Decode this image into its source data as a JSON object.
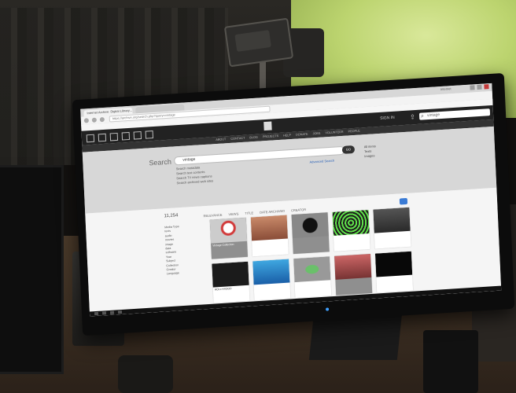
{
  "browser": {
    "tabs": [
      {
        "label": "Internet Archive: Digital Library..."
      },
      {
        "label": ""
      }
    ],
    "address": "https://archive.org/search.php?query=vintage",
    "window_label": "Internet"
  },
  "site": {
    "signin": "SIGN IN",
    "search_placeholder": "vintage",
    "nav": [
      "ABOUT",
      "CONTACT",
      "BLOG",
      "PROJECTS",
      "HELP",
      "DONATE",
      "JOBS",
      "VOLUNTEER",
      "PEOPLE"
    ]
  },
  "search": {
    "title": "Search",
    "query": "vintage",
    "go": "GO",
    "options": [
      "Search metadata",
      "Search text contents",
      "Search TV news captions",
      "Search archived web sites"
    ],
    "advanced": "Advanced Search",
    "radios": [
      "All items",
      "Texts",
      "Images"
    ]
  },
  "results": {
    "count": "11,254",
    "filters": [
      "RELEVANCE",
      "VIEWS",
      "TITLE",
      "DATE ARCHIVED",
      "CREATOR"
    ],
    "facets": [
      "Media Type",
      "texts",
      "audio",
      "movies",
      "image",
      "data",
      "software",
      "Year",
      "Subject",
      "Collection",
      "Creator",
      "Language"
    ],
    "tiles": [
      {
        "style": "collection red",
        "caption": "Vintage Collection",
        "stats": ""
      },
      {
        "style": "face",
        "caption": "",
        "stats": ""
      },
      {
        "style": "collection black-circle",
        "caption": "",
        "stats": ""
      },
      {
        "style": "spiral",
        "caption": "",
        "stats": ""
      },
      {
        "style": "portrait",
        "caption": "",
        "stats": ""
      },
      {
        "style": "poster",
        "caption": "HOLLYWOOD",
        "stats": ""
      },
      {
        "style": "blue",
        "caption": "",
        "stats": ""
      },
      {
        "style": "green-bottle",
        "caption": "",
        "stats": ""
      },
      {
        "style": "collection person",
        "caption": "",
        "stats": ""
      },
      {
        "style": "dark",
        "caption": "",
        "stats": ""
      }
    ]
  },
  "colors": {
    "greenscreen": "#bcd46f",
    "link_blue": "#2b62b8",
    "site_header": "#222222"
  }
}
